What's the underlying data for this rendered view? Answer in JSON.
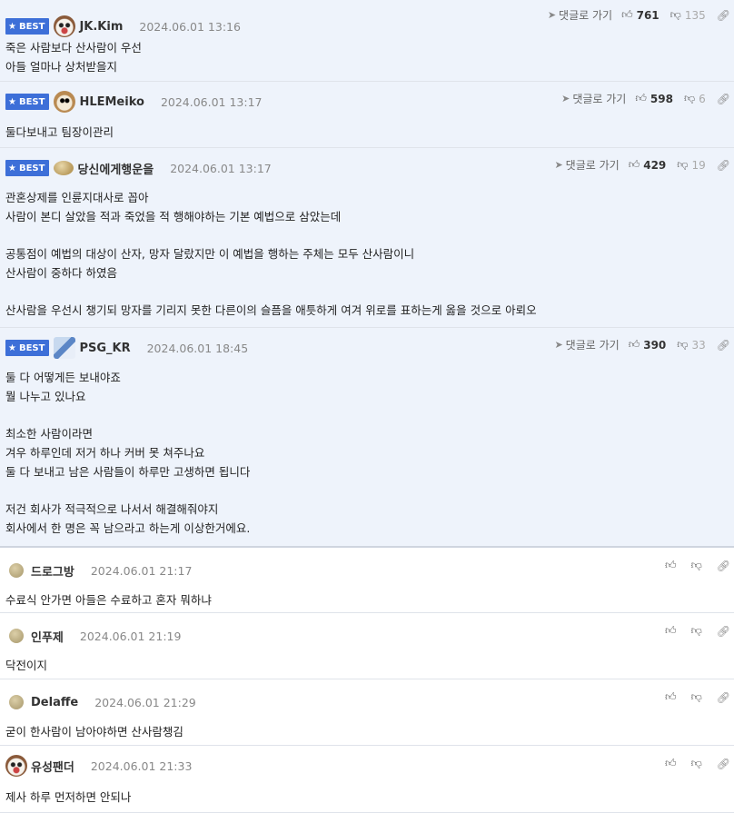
{
  "goto_label": "댓글로 가기",
  "best_label": "BEST",
  "comments": [
    {
      "nick": "JK.Kim",
      "date": "2024.06.01 13:16",
      "up": "761",
      "down": "135",
      "body": "죽은 사람보다 산사람이 우선\n아들 얼마나 상처받을지"
    },
    {
      "nick": "HLEMeiko",
      "date": "2024.06.01 13:17",
      "up": "598",
      "down": "6",
      "body": "둘다보내고 팀장이관리"
    },
    {
      "nick": "당신에게행운을",
      "date": "2024.06.01 13:17",
      "up": "429",
      "down": "19",
      "body": "관혼상제를 인륜지대사로 꼽아\n사람이 본디 살았을 적과 죽었을 적 행해야하는 기본 예법으로 삼았는데\n\n공통점이 예법의 대상이 산자, 망자 달랐지만 이 예법을 행하는 주체는 모두 산사람이니\n산사람이 중하다 하였음\n\n산사람을 우선시 챙기되 망자를 기리지 못한 다른이의 슬픔을 애틋하게 여겨 위로를 표하는게 옳을 것으로 아뢰오"
    },
    {
      "nick": "PSG_KR",
      "date": "2024.06.01 18:45",
      "up": "390",
      "down": "33",
      "body": "둘 다 어떻게든 보내야죠\n뭘 나누고 있나요\n\n최소한 사람이라면\n겨우 하루인데 저거 하나 커버 못 쳐주나요\n둘 다 보내고 남은 사람들이 하루만 고생하면 됩니다\n\n저건 회사가 적극적으로 나서서 해결해줘야지\n회사에서 한 명은 꼭 남으라고 하는게 이상한거에요."
    },
    {
      "nick": "드로그방",
      "date": "2024.06.01 21:17",
      "body": "수료식 안가면 아들은 수료하고 혼자 뭐하냐"
    },
    {
      "nick": "인푸제",
      "date": "2024.06.01 21:19",
      "body": "닥전이지"
    },
    {
      "nick": "Delaffe",
      "date": "2024.06.01 21:29",
      "body": "굳이 한사람이 남아야하면 산사람챙김"
    },
    {
      "nick": "유성팬더",
      "date": "2024.06.01 21:33",
      "body": "제사 하루 먼저하면 안되나"
    }
  ]
}
